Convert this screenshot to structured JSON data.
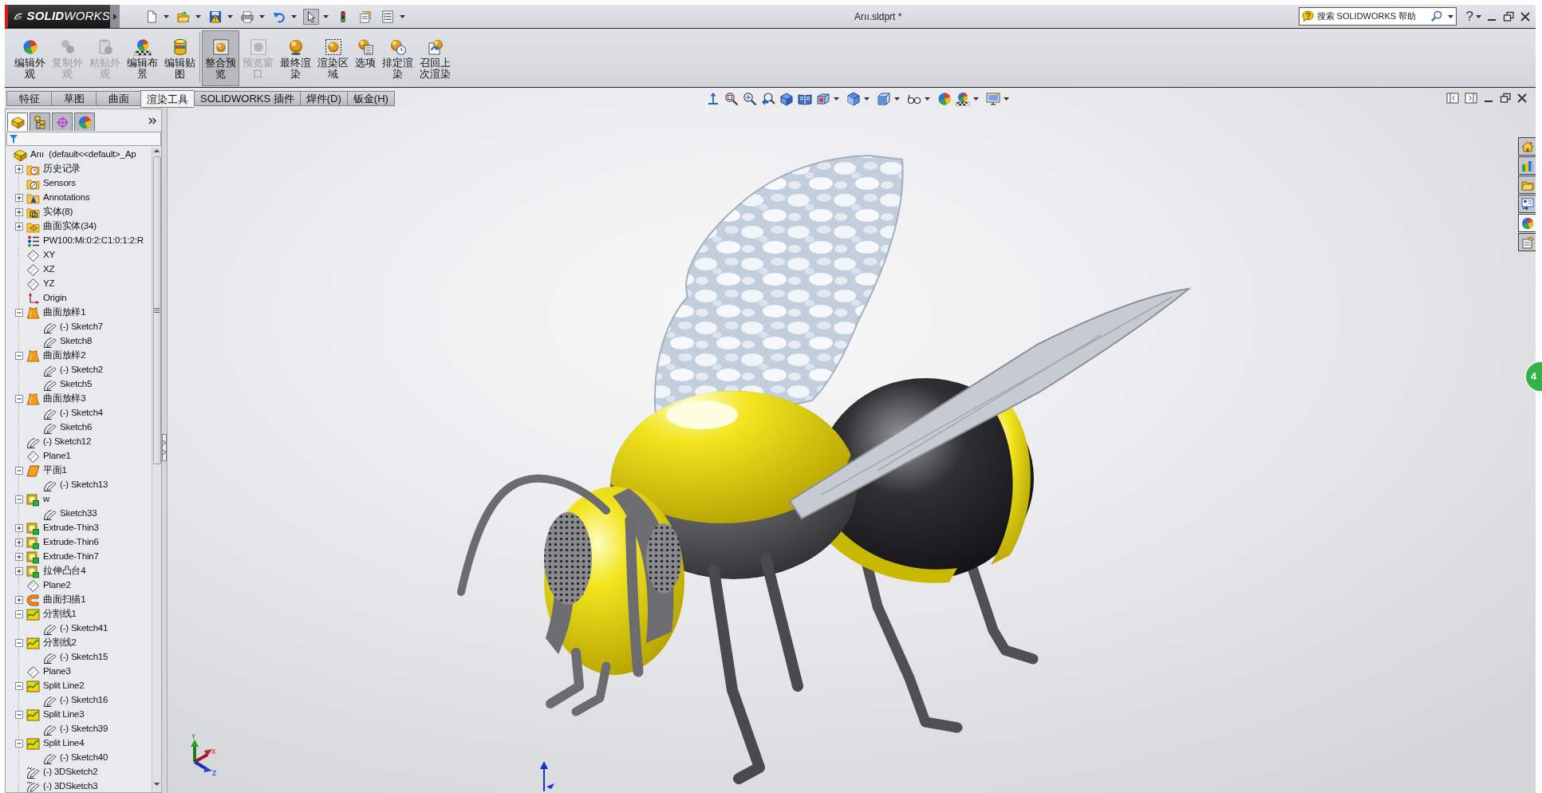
{
  "title_bar": {
    "logo_text": "**SOLID**WORKS",
    "document_title": "Arıı.sldprt *",
    "search": {
      "placeholder": "搜索 SOLIDWORKS 帮助"
    },
    "help_glyph": "?"
  },
  "quick_access": [
    {
      "menu": true,
      "pressed": false
    },
    {
      "menu": true,
      "pressed": false
    },
    {
      "menu": true,
      "pressed": false
    },
    {
      "menu": true,
      "pressed": false
    },
    {
      "menu": true,
      "pressed": false
    },
    {
      "menu": true,
      "pressed": true
    },
    {
      "menu": false,
      "pressed": false
    },
    {
      "menu": false,
      "pressed": false
    },
    {
      "menu": true,
      "pressed": false
    }
  ],
  "ribbon_groups": [
    [
      {
        "label": "编辑外观",
        "disabled": false,
        "selected": false
      },
      {
        "label": "复制外观",
        "disabled": true,
        "selected": false
      },
      {
        "label": "粘贴外观",
        "disabled": true,
        "selected": false
      },
      {
        "label": "编辑布景",
        "disabled": false,
        "selected": false
      },
      {
        "label": "编辑贴图",
        "disabled": false,
        "selected": false
      }
    ],
    [
      {
        "label": "整合预览",
        "disabled": false,
        "selected": true
      },
      {
        "label": "预览窗口",
        "disabled": true,
        "selected": false
      },
      {
        "label": "最终渲染",
        "disabled": false,
        "selected": false
      },
      {
        "label": "渲染区域",
        "disabled": false,
        "selected": false
      },
      {
        "label": "选项",
        "disabled": false,
        "selected": false
      },
      {
        "label": "排定渲染",
        "disabled": false,
        "selected": false
      },
      {
        "label": "召回上次渲染",
        "disabled": false,
        "selected": false
      }
    ]
  ],
  "command_tabs": [
    {
      "label": "特征",
      "selected": false
    },
    {
      "label": "草图",
      "selected": false
    },
    {
      "label": "曲面",
      "selected": false
    },
    {
      "label": "渲染工具",
      "selected": true
    },
    {
      "label": "SOLIDWORKS 插件",
      "selected": false
    },
    {
      "label": "焊件(D)",
      "selected": false
    },
    {
      "label": "钣金(H)",
      "selected": false
    }
  ],
  "view_toolbar": [
    {
      "menu": false
    },
    {
      "menu": false
    },
    {
      "menu": false
    },
    {
      "menu": false
    },
    {
      "menu": false
    },
    {
      "menu": false
    },
    {
      "menu": true
    },
    {
      "menu": true
    },
    {
      "menu": true
    },
    {
      "menu": true
    },
    {
      "menu": false
    },
    {
      "menu": true
    },
    {
      "menu": true
    }
  ],
  "feature_manager": {
    "tabs": [
      {
        "selected": true
      },
      {
        "selected": false
      },
      {
        "selected": false
      },
      {
        "selected": false
      }
    ],
    "tree": {
      "label": "Arıı  (default<<default>_Ap",
      "kind": "part",
      "children": [
        {
          "label": "历史记录",
          "kind": "history",
          "expanded": false
        },
        {
          "label": "Sensors",
          "kind": "sensors"
        },
        {
          "label": "Annotations",
          "kind": "annotations",
          "expanded": false
        },
        {
          "label": "实体(8)",
          "kind": "solid_bodies",
          "expanded": false
        },
        {
          "label": "曲面实体(34)",
          "kind": "surface_bodies",
          "expanded": false
        },
        {
          "label": "PW100:Mi:0:2:C1:0:1:2:R",
          "kind": "material"
        },
        {
          "label": "XY",
          "kind": "plane"
        },
        {
          "label": "XZ",
          "kind": "plane"
        },
        {
          "label": "YZ",
          "kind": "plane"
        },
        {
          "label": "Origin",
          "kind": "origin"
        },
        {
          "label": "曲面放样1",
          "kind": "loft",
          "expanded": true,
          "children": [
            {
              "label": "(-) Sketch7",
              "kind": "sketch"
            },
            {
              "label": "Sketch8",
              "kind": "sketch"
            }
          ]
        },
        {
          "label": "曲面放样2",
          "kind": "loft",
          "expanded": true,
          "children": [
            {
              "label": "(-) Sketch2",
              "kind": "sketch"
            },
            {
              "label": "Sketch5",
              "kind": "sketch"
            }
          ]
        },
        {
          "label": "曲面放样3",
          "kind": "loft",
          "expanded": true,
          "children": [
            {
              "label": "(-) Sketch4",
              "kind": "sketch"
            },
            {
              "label": "Sketch6",
              "kind": "sketch"
            }
          ]
        },
        {
          "label": "(-) Sketch12",
          "kind": "sketch"
        },
        {
          "label": "Plane1",
          "kind": "plane"
        },
        {
          "label": "平面1",
          "kind": "planar_surface",
          "expanded": true,
          "children": [
            {
              "label": "(-) Sketch13",
              "kind": "sketch"
            }
          ]
        },
        {
          "label": "w",
          "kind": "extrude",
          "expanded": true,
          "children": [
            {
              "label": "Sketch33",
              "kind": "sketch"
            }
          ]
        },
        {
          "label": "Extrude-Thin3",
          "kind": "extrude",
          "expanded": false
        },
        {
          "label": "Extrude-Thin6",
          "kind": "extrude",
          "expanded": false
        },
        {
          "label": "Extrude-Thin7",
          "kind": "extrude",
          "expanded": false
        },
        {
          "label": "拉伸凸台4",
          "kind": "extrude",
          "expanded": false
        },
        {
          "label": "Plane2",
          "kind": "plane"
        },
        {
          "label": "曲面扫描1",
          "kind": "sweep",
          "expanded": false
        },
        {
          "label": "分割线1",
          "kind": "split_line",
          "expanded": true,
          "children": [
            {
              "label": "(-) Sketch41",
              "kind": "sketch"
            }
          ]
        },
        {
          "label": "分割线2",
          "kind": "split_line",
          "expanded": true,
          "children": [
            {
              "label": "(-) Sketch15",
              "kind": "sketch"
            }
          ]
        },
        {
          "label": "Plane3",
          "kind": "plane"
        },
        {
          "label": "Split Line2",
          "kind": "split_line",
          "expanded": true,
          "children": [
            {
              "label": "(-) Sketch16",
              "kind": "sketch"
            }
          ]
        },
        {
          "label": "Split Line3",
          "kind": "split_line",
          "expanded": true,
          "children": [
            {
              "label": "(-) Sketch39",
              "kind": "sketch"
            }
          ]
        },
        {
          "label": "Split Line4",
          "kind": "split_line",
          "expanded": true,
          "children": [
            {
              "label": "(-) Sketch40",
              "kind": "sketch"
            }
          ]
        },
        {
          "label": "(-) 3DSketch2",
          "kind": "sketch_3d"
        },
        {
          "label": "(-) 3DSketch3",
          "kind": "sketch_3d"
        }
      ]
    }
  },
  "task_pane_tabs": [
    {
      "selected": false
    },
    {
      "selected": false
    },
    {
      "selected": false
    },
    {
      "selected": false
    },
    {
      "selected": true
    },
    {
      "selected": false
    }
  ],
  "view_triad": {
    "x_label": "X",
    "y_label": "Y",
    "z_label": "Z"
  },
  "edge_widget": {
    "text": "4"
  }
}
